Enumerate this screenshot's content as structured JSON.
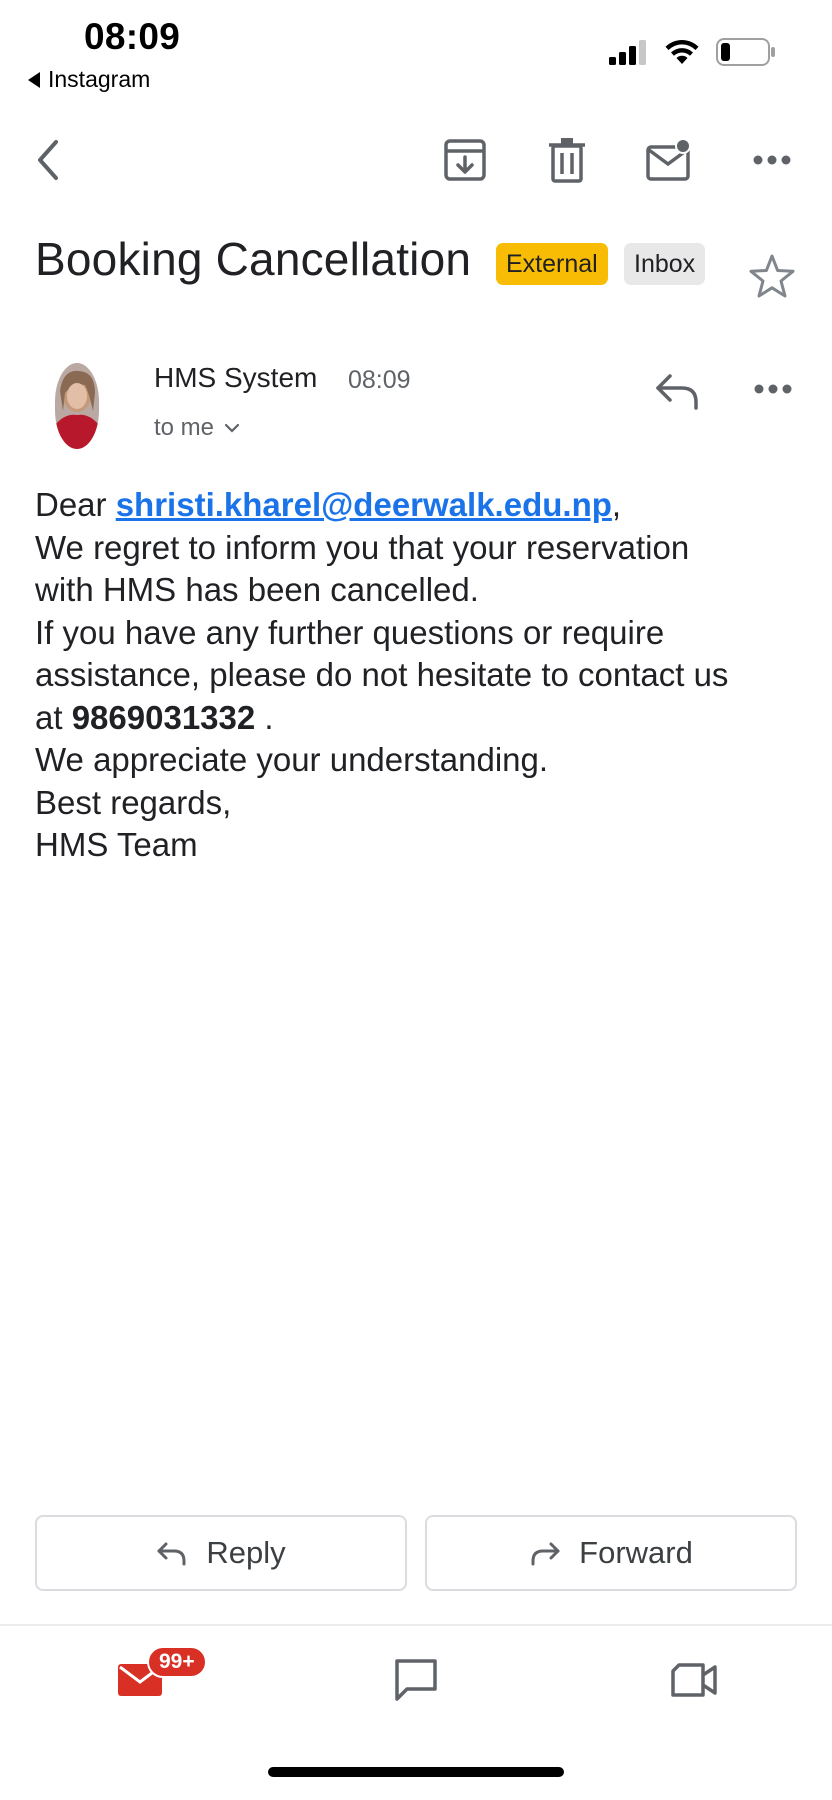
{
  "status_bar": {
    "time": "08:09",
    "back_app": "Instagram"
  },
  "toolbar": {
    "icons": [
      "back-arrow-icon",
      "archive-icon",
      "trash-icon",
      "mark-unread-icon",
      "more-icon"
    ]
  },
  "email": {
    "subject": "Booking Cancellation",
    "labels": [
      "External",
      "Inbox"
    ],
    "sender": "HMS System",
    "time": "08:09",
    "recipient": "to me",
    "body": {
      "greeting_prefix": "Dear ",
      "greeting_email": "shristi.kharel@deerwalk.edu.np",
      "greeting_suffix": ",",
      "line1": "We regret to inform you that your reservation",
      "line2": "with HMS has been cancelled.",
      "line3": "If you have any further questions or require",
      "line4": "assistance, please do not hesitate to contact us",
      "line5_prefix": "at ",
      "phone": "9869031332",
      "line5_suffix": " .",
      "line6": "We appreciate your understanding.",
      "line7": "Best regards,",
      "line8": "HMS Team"
    }
  },
  "actions": {
    "reply_label": "Reply",
    "forward_label": "Forward"
  },
  "bottom_nav": {
    "mail_badge": "99+",
    "items": [
      "mail-icon",
      "chat-icon",
      "meet-video-icon"
    ]
  },
  "colors": {
    "external_badge": "#f9bc04",
    "inbox_badge": "#e8e8e8",
    "link": "#1a73e8",
    "mail_red": "#d93025"
  }
}
